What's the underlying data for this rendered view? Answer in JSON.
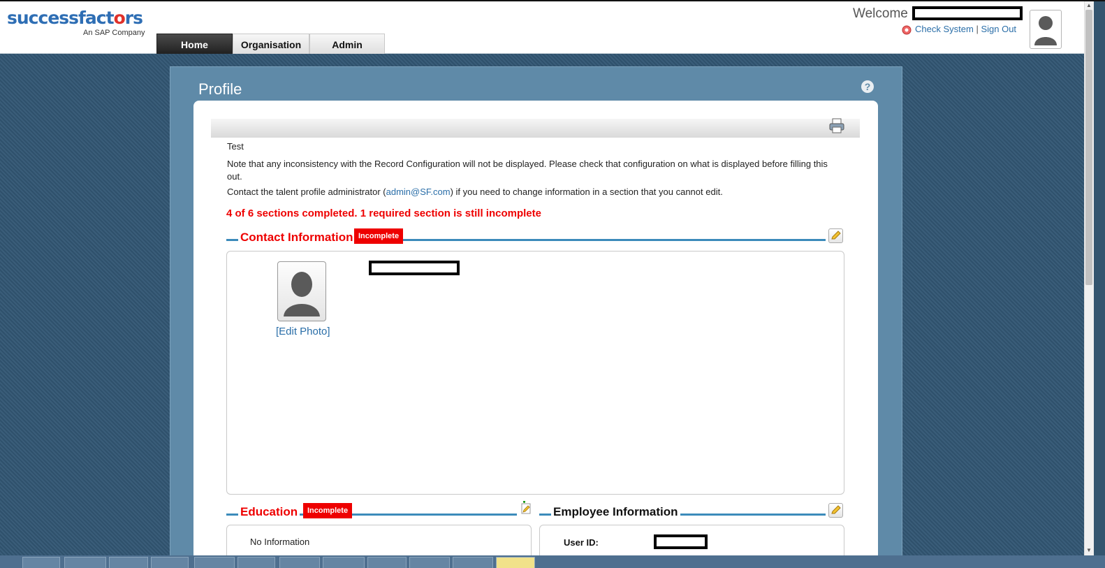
{
  "header": {
    "logo_text": "successfactors",
    "logo_subtitle": "An SAP Company",
    "tabs": [
      {
        "label": "Home",
        "active": true
      },
      {
        "label": "Organisation",
        "active": false
      },
      {
        "label": "Admin",
        "active": false
      }
    ],
    "welcome_label": "Welcome",
    "check_system_label": "Check System",
    "separator": "|",
    "sign_out_label": "Sign Out"
  },
  "page": {
    "title": "Profile",
    "help_symbol": "?"
  },
  "content": {
    "test_label": "Test",
    "note": "Note that any inconsistency with the Record Configuration will not be displayed. Please check that configuration on what is displayed before filling this out.",
    "contact_prefix": "Contact the talent profile administrator (",
    "admin_email": "admin@SF.com",
    "contact_suffix": ") if you need to change information in a section that you cannot edit.",
    "completion_status": "4 of 6 sections completed.   1 required section is still incomplete"
  },
  "sections": {
    "contact": {
      "title": "Contact Information",
      "badge": "Incomplete",
      "edit_photo_label": "[Edit Photo]"
    },
    "education": {
      "title": "Education",
      "badge": "Incomplete",
      "empty_text": "No Information"
    },
    "employee": {
      "title": "Employee Information",
      "user_id_label": "User ID:"
    }
  },
  "colors": {
    "accent_blue": "#3c8bbb",
    "incomplete_red": "#e00000",
    "link_blue": "#2a6ea8",
    "page_background": "#34556f",
    "panel": "#5f8aa8"
  }
}
